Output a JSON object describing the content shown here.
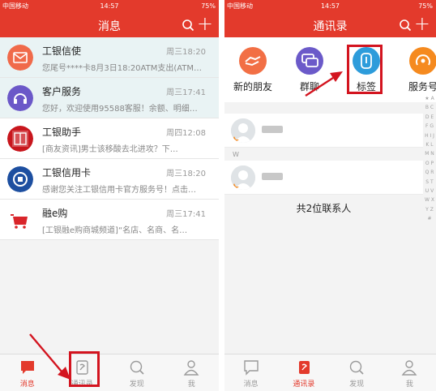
{
  "colors": {
    "brand": "#e33a2c",
    "annotation": "#d3141f"
  },
  "left": {
    "status": {
      "carrier": "中国移动 ",
      "time": "14:57",
      "battery": "75%"
    },
    "title": "消息",
    "messages": [
      {
        "name": "工银信使",
        "time": "周三18:20",
        "preview": "您尾号****卡8月3日18:20ATM支出(ATM…",
        "icon": "mail-icon"
      },
      {
        "name": "客户服务",
        "time": "周三17:41",
        "preview": "您好，欢迎使用95588客服！余额、明细…",
        "icon": "headset-icon"
      },
      {
        "name": "工银助手",
        "time": "周四12:08",
        "preview": "[商友资讯]男士该移酸去北进攻？下…",
        "icon": "helper-logo"
      },
      {
        "name": "工银信用卡",
        "time": "周三18:20",
        "preview": "感谢您关注工银信用卡官方服务号！点击…",
        "icon": "icbc-logo"
      },
      {
        "name": "融e购",
        "time": "周三17:41",
        "preview": "[工银融e购商城频道]“名店、名商、名…",
        "icon": "shop-logo"
      }
    ],
    "tabs": [
      "消息",
      "通讯录",
      "发现",
      "我"
    ],
    "active_tab": 0
  },
  "right": {
    "status": {
      "carrier": "中国移动 ",
      "time": "14:57",
      "battery": "75%"
    },
    "title": "通讯录",
    "quick_items": [
      {
        "label": "新的朋友",
        "icon": "handshake-icon",
        "color": "#f26f45"
      },
      {
        "label": "群聊",
        "icon": "chat-bubbles-icon",
        "color": "#6b5ac9"
      },
      {
        "label": "标签",
        "icon": "tag-icon",
        "color": "#2d9cdb"
      },
      {
        "label": "服务号",
        "icon": "service-icon",
        "color": "#f58a1f"
      }
    ],
    "section_letter": "W",
    "contact_count": "共2位联系人",
    "index_letters": "★ A B C D E F G H I J K L M N O P Q R S T U V W X Y Z #",
    "tabs": [
      "消息",
      "通讯录",
      "发现",
      "我"
    ],
    "active_tab": 1
  }
}
